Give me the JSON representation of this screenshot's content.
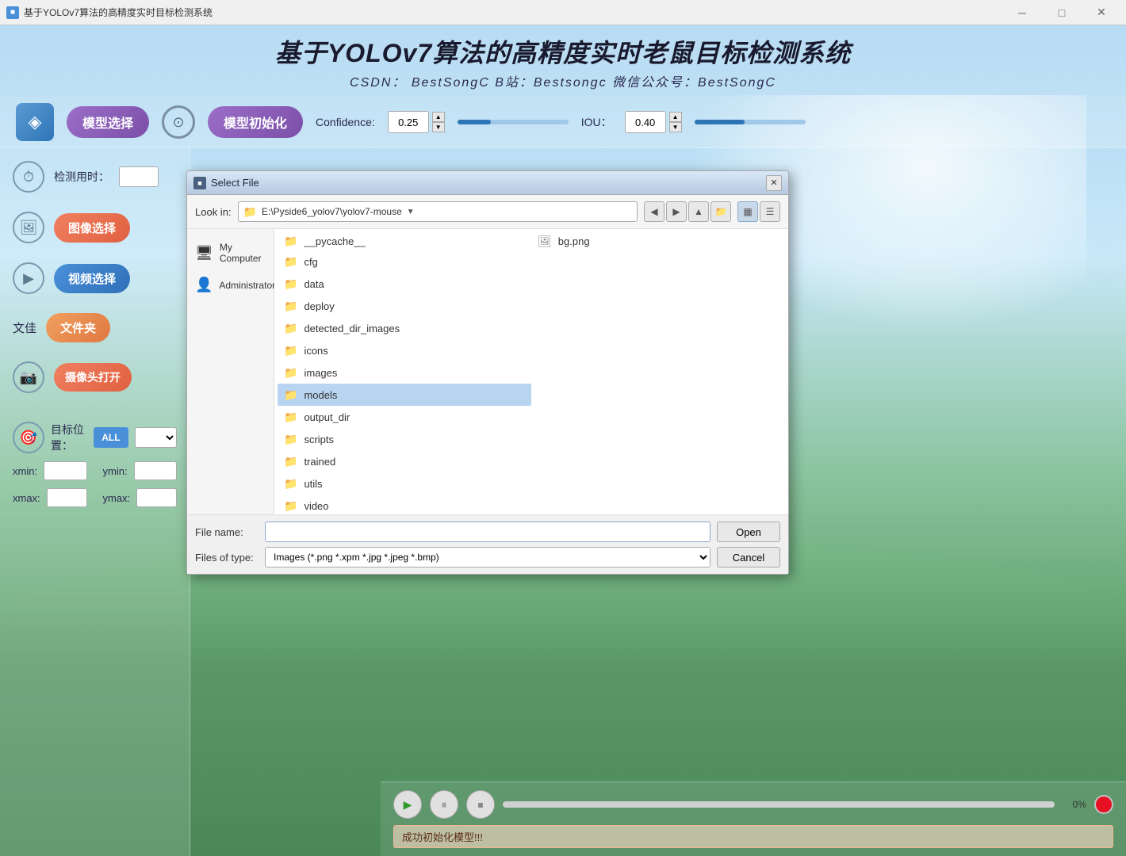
{
  "window": {
    "title": "基于YOLOv7算法的高精度实时目标检测系统",
    "title_controls": {
      "minimize": "─",
      "maximize": "□",
      "close": "✕"
    }
  },
  "app": {
    "title": "基于YOLOv7算法的高精度实时老鼠目标检测系统",
    "subtitle": "CSDN： BestSongC   B站：Bestsongc   微信公众号：BestSongC"
  },
  "toolbar": {
    "model_select_label": "模型选择",
    "model_init_label": "模型初始化",
    "confidence_label": "Confidence:",
    "confidence_value": "0.25",
    "iou_label": "IOU：",
    "iou_value": "0.40",
    "confidence_fill_pct": 30,
    "iou_fill_pct": 45
  },
  "left_panel": {
    "detect_time_label": "检测用时：",
    "image_select_label": "图像选择",
    "video_select_label": "视频选择",
    "folder_label": "文佳",
    "folder_btn_label": "文件夹",
    "camera_btn_label": "摄像头打开"
  },
  "target": {
    "position_label": "目标位置：",
    "all_label": "ALL",
    "xmin_label": "xmin:",
    "ymin_label": "ymin:",
    "xmax_label": "xmax:",
    "ymax_label": "ymax:"
  },
  "playback": {
    "progress_label": "0%"
  },
  "status": {
    "message": "成功初始化模型!!!"
  },
  "file_dialog": {
    "title": "Select File",
    "look_in_label": "Look in:",
    "path": "E:\\Pyside6_yolov7\\yolov7-mouse",
    "nav_items": [
      {
        "id": "my-computer",
        "label": "My Computer",
        "icon": "🖥"
      },
      {
        "id": "administrator",
        "label": "Administrator",
        "icon": "👤"
      }
    ],
    "files": [
      {
        "name": "__pycache__",
        "type": "folder"
      },
      {
        "name": "bg.png",
        "type": "image"
      },
      {
        "name": "cfg",
        "type": "folder"
      },
      {
        "name": "data",
        "type": "folder"
      },
      {
        "name": "deploy",
        "type": "folder"
      },
      {
        "name": "detected_dir_images",
        "type": "folder"
      },
      {
        "name": "icons",
        "type": "folder"
      },
      {
        "name": "images",
        "type": "folder"
      },
      {
        "name": "models",
        "type": "folder",
        "selected": true
      },
      {
        "name": "output_dir",
        "type": "folder"
      },
      {
        "name": "scripts",
        "type": "folder"
      },
      {
        "name": "trained",
        "type": "folder"
      },
      {
        "name": "utils",
        "type": "folder"
      },
      {
        "name": "video",
        "type": "folder"
      }
    ],
    "filename_label": "File name:",
    "filename_value": "",
    "open_btn_label": "Open",
    "filetype_label": "Files of type:",
    "filetype_value": "Images (*.png *.xpm *.jpg *.jpeg *.bmp)",
    "cancel_btn_label": "Cancel",
    "nav_buttons": {
      "back": "◀",
      "forward": "▶",
      "up": "▲",
      "folder_icon": "📁",
      "view_list": "▦",
      "view_detail": "☰"
    }
  }
}
